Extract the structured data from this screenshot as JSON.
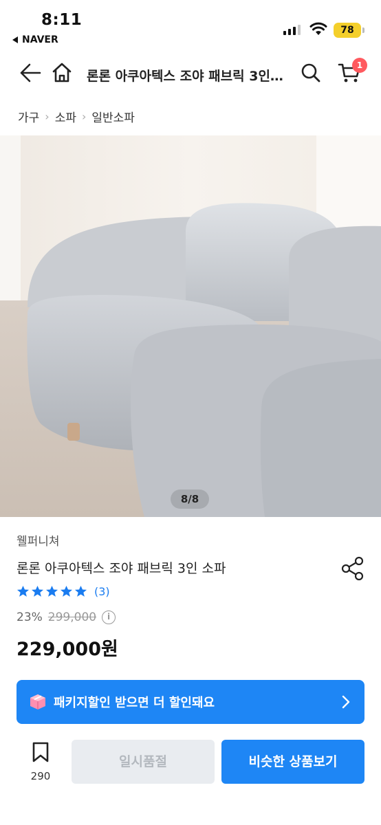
{
  "status_bar": {
    "time": "8:11",
    "back_app": "NAVER",
    "battery": "78"
  },
  "header": {
    "title": "론론 아쿠아텍스 조야 패브릭 3인 소파",
    "cart_count": "1"
  },
  "breadcrumb": [
    "가구",
    "소파",
    "일반소파"
  ],
  "gallery": {
    "counter": "8/8"
  },
  "product": {
    "brand": "웰퍼니쳐",
    "name": "론론 아쿠아텍스 조야 패브릭 3인 소파",
    "rating_stars": 5,
    "review_count": "(3)",
    "discount": "23%",
    "original_price": "299,000",
    "price": "229,000원"
  },
  "banner": {
    "text": "패키지할인 받으면 더 할인돼요"
  },
  "bottom_bar": {
    "favorite_count": "290",
    "soldout_label": "일시품절",
    "similar_label": "비슷한 상품보기"
  },
  "colors": {
    "accent": "#1e86f5",
    "star": "#1a7cf0",
    "badge": "#ff5a5f",
    "battery": "#f4cf2b"
  }
}
